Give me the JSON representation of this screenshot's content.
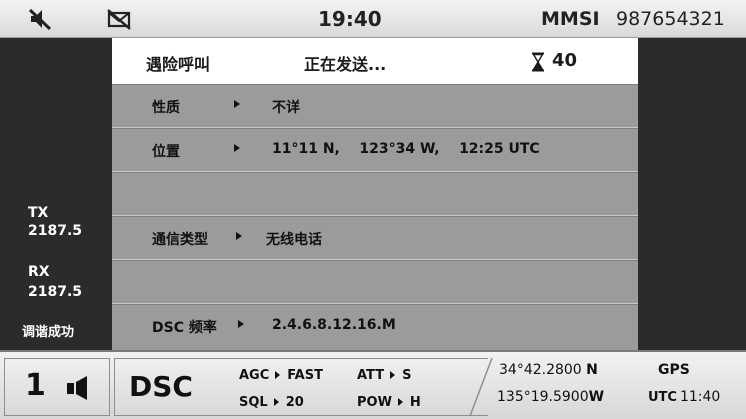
{
  "topbar": {
    "mute_icon": "speaker-muted-icon",
    "mail_icon": "message-crossed-icon",
    "clock": "19:40",
    "mmsi_label": "MMSI",
    "mmsi_value": "987654321"
  },
  "left": {
    "tx_label": "TX",
    "tx_freq": "2187.5",
    "rx_label": "RX",
    "rx_freq": "2187.5",
    "tune_status": "调谐成功"
  },
  "header": {
    "title": "遇险呼叫",
    "status": "正在发送...",
    "timer_icon": "hourglass-icon",
    "countdown": "40"
  },
  "rows": [
    {
      "key": "性质",
      "value": "不详"
    },
    {
      "key": "位置",
      "value": "11°11 N,    123°34 W,    12:25 UTC"
    },
    {
      "key": "",
      "value": ""
    },
    {
      "key": "通信类型",
      "value": "无线电话"
    },
    {
      "key": "",
      "value": ""
    },
    {
      "key": "DSC 频率",
      "value": "2.4.6.8.12.16.M"
    }
  ],
  "bottom": {
    "channel": "1",
    "channel_icon": "speaker-icon",
    "mode": "DSC",
    "agc_label": "AGC",
    "agc_value": "FAST",
    "att_label": "ATT",
    "att_value": "S",
    "sql_label": "SQL",
    "sql_value": "20",
    "pow_label": "POW",
    "pow_value": "H",
    "lat_value": "34°42.2800",
    "lat_hemi": "N",
    "lon_value": "135°19.5900",
    "lon_hemi": "W",
    "gps_label": "GPS",
    "utc_label": "UTC",
    "utc_value": "11:40"
  },
  "colors": {
    "background": "#2b2b2b",
    "panel": "#9b9b9b",
    "header": "#ffffff",
    "bar": "#e6e6e6"
  }
}
